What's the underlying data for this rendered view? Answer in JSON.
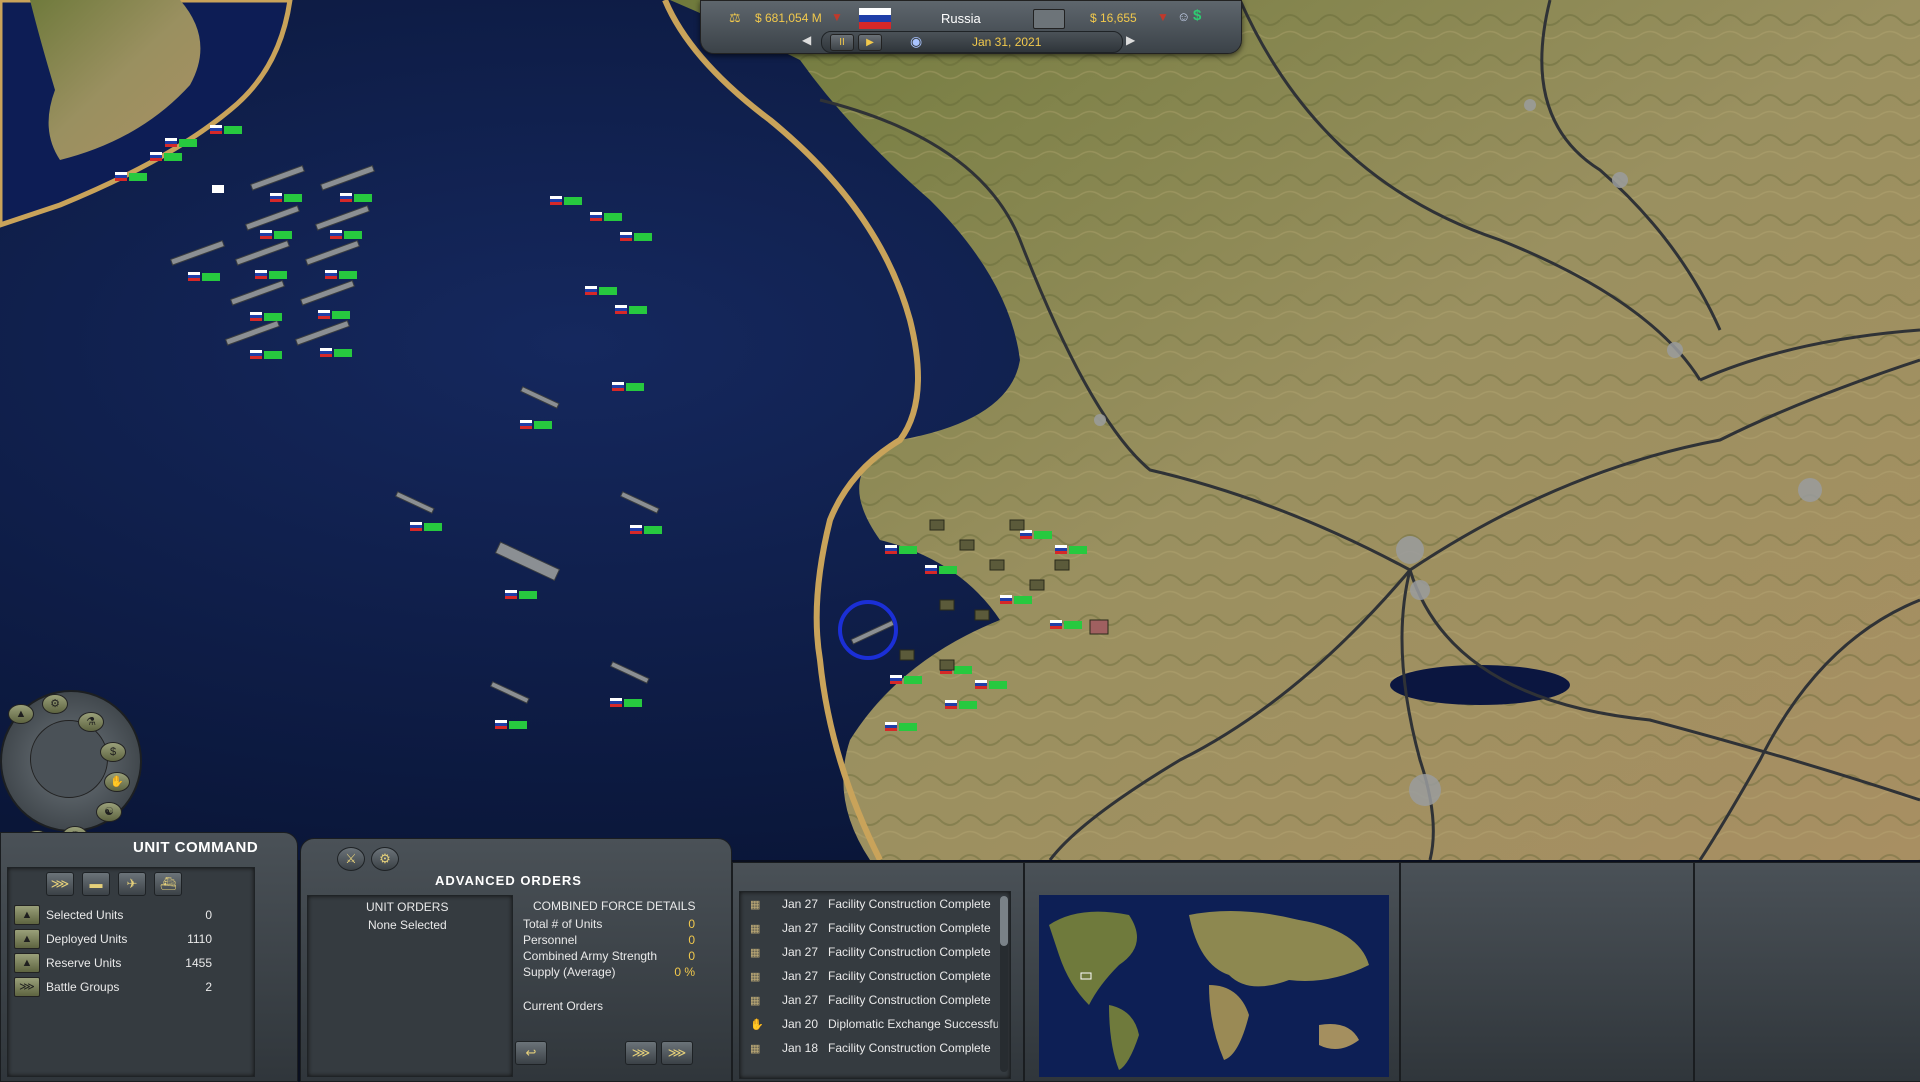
{
  "topbar": {
    "funds": "$ 681,054 M",
    "country": "Russia",
    "income": "$ 16,655",
    "date": "Jan 31, 2021",
    "pause_label": "II",
    "play_label": "▶"
  },
  "unit_command": {
    "title": "UNIT COMMAND",
    "rows": [
      {
        "label": "Selected Units",
        "value": "0"
      },
      {
        "label": "Deployed Units",
        "value": "1110"
      },
      {
        "label": "Reserve Units",
        "value": "1455"
      },
      {
        "label": "Battle Groups",
        "value": "2"
      }
    ]
  },
  "advanced_orders": {
    "title": "ADVANCED ORDERS",
    "unit_orders_header": "UNIT ORDERS",
    "unit_orders_value": "None Selected",
    "details_header": "COMBINED FORCE DETAILS",
    "details": [
      {
        "label": "Total # of Units",
        "value": "0"
      },
      {
        "label": "Personnel",
        "value": "0"
      },
      {
        "label": "Combined Army Strength",
        "value": "0"
      },
      {
        "label": "Supply (Average)",
        "value": "0 %"
      }
    ],
    "current_orders_label": "Current Orders"
  },
  "news": [
    {
      "date": "Jan 27",
      "text": "Facility Construction Complete"
    },
    {
      "date": "Jan 27",
      "text": "Facility Construction Complete"
    },
    {
      "date": "Jan 27",
      "text": "Facility Construction Complete"
    },
    {
      "date": "Jan 27",
      "text": "Facility Construction Complete"
    },
    {
      "date": "Jan 27",
      "text": "Facility Construction Complete"
    },
    {
      "date": "Jan 20",
      "text": "Diplomatic Exchange Successful"
    },
    {
      "date": "Jan 18",
      "text": "Facility Construction Complete"
    }
  ],
  "colors": {
    "ocean": "#0b1a4a",
    "land": "#8f8a55",
    "gold_text": "#f2c94c",
    "panel": "#3f464c"
  }
}
